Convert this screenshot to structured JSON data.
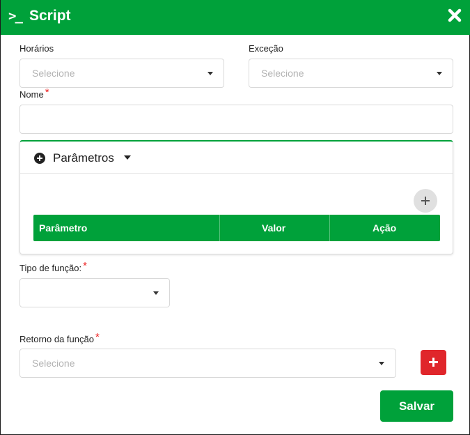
{
  "header": {
    "prompt_symbol": ">_",
    "title": "Script",
    "close_icon": "close-icon"
  },
  "form": {
    "horarios": {
      "label": "Horários",
      "placeholder": "Selecione"
    },
    "excecao": {
      "label": "Exceção",
      "placeholder": "Selecione"
    },
    "nome": {
      "label": "Nome",
      "required_mark": "*",
      "value": ""
    },
    "parametros": {
      "title": "Parâmetros",
      "add_icon": "plus-icon",
      "columns": [
        "Parâmetro",
        "Valor",
        "Ação"
      ],
      "rows": []
    },
    "tipo_funcao": {
      "label": "Tipo de função:",
      "required_mark": "*",
      "value": ""
    },
    "retorno_funcao": {
      "label": "Retorno da função",
      "required_mark": "*",
      "placeholder": "Selecione"
    },
    "save_label": "Salvar"
  },
  "colors": {
    "primary_green": "#00a13a",
    "danger_red": "#e0262b",
    "required_red": "#ee2222"
  }
}
